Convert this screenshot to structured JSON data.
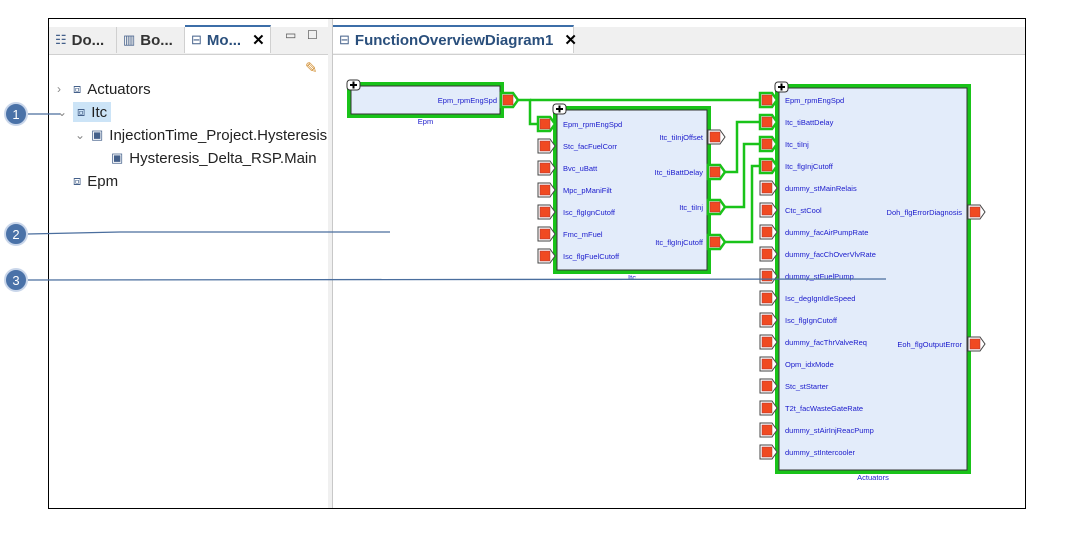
{
  "left_panel": {
    "tabs": [
      {
        "label": "Do...",
        "icon": "outline-icon"
      },
      {
        "label": "Bo...",
        "icon": "book-icon"
      },
      {
        "label": "Mo...",
        "icon": "model-icon",
        "active": true
      }
    ],
    "tree": [
      {
        "label": "Actuators",
        "icon": "component-icon",
        "expanded": false,
        "level": 0
      },
      {
        "label": "Itc",
        "icon": "component-icon",
        "expanded": true,
        "level": 0,
        "selected": true
      },
      {
        "label": "InjectionTime_Project.Hysteresis",
        "icon": "module-icon",
        "expanded": true,
        "level": 1
      },
      {
        "label": "Hysteresis_Delta_RSP.Main",
        "icon": "module-icon",
        "level": 2
      },
      {
        "label": "Epm",
        "icon": "component-icon",
        "level": 0
      }
    ]
  },
  "editor": {
    "tab_label": "FunctionOverviewDiagram1"
  },
  "diagram": {
    "colors": {
      "connected": "#19c319",
      "block_fill": "#e3ecfa",
      "port": "#f04a22",
      "text": "#1a1acc"
    },
    "epm": {
      "name": "Epm",
      "outputs": [
        "Epm_rpmEngSpd"
      ]
    },
    "itc": {
      "name": "Itc",
      "inputs": [
        "Epm_rpmEngSpd",
        "Stc_facFuelCorr",
        "Bvc_uBatt",
        "Mpc_pManiFilt",
        "Isc_flgIgnCutoff",
        "Fmc_mFuel",
        "Isc_flgFuelCutoff"
      ],
      "outputs": [
        "Itc_tiInjOffset",
        "Itc_tiBattDelay",
        "Itc_tiInj",
        "Itc_flgInjCutoff"
      ]
    },
    "actuators": {
      "name": "Actuators",
      "inputs": [
        "Epm_rpmEngSpd",
        "Itc_tiBattDelay",
        "Itc_tiInj",
        "Itc_flgInjCutoff",
        "dummy_stMainRelais",
        "Ctc_stCool",
        "dummy_facAirPumpRate",
        "dummy_facChOverVlvRate",
        "dummy_stFuelPump",
        "Isc_degIgnIdleSpeed",
        "Isc_flgIgnCutoff",
        "dummy_facThrValveReq",
        "Opm_idxMode",
        "Stc_stStarter",
        "T2t_facWasteGateRate",
        "dummy_stAirInjReacPump",
        "dummy_stIntercooler"
      ],
      "outputs": [
        "Doh_flgErrorDiagnosis",
        "Eoh_flgOutputError"
      ]
    }
  },
  "callouts": [
    "1",
    "2",
    "3"
  ]
}
